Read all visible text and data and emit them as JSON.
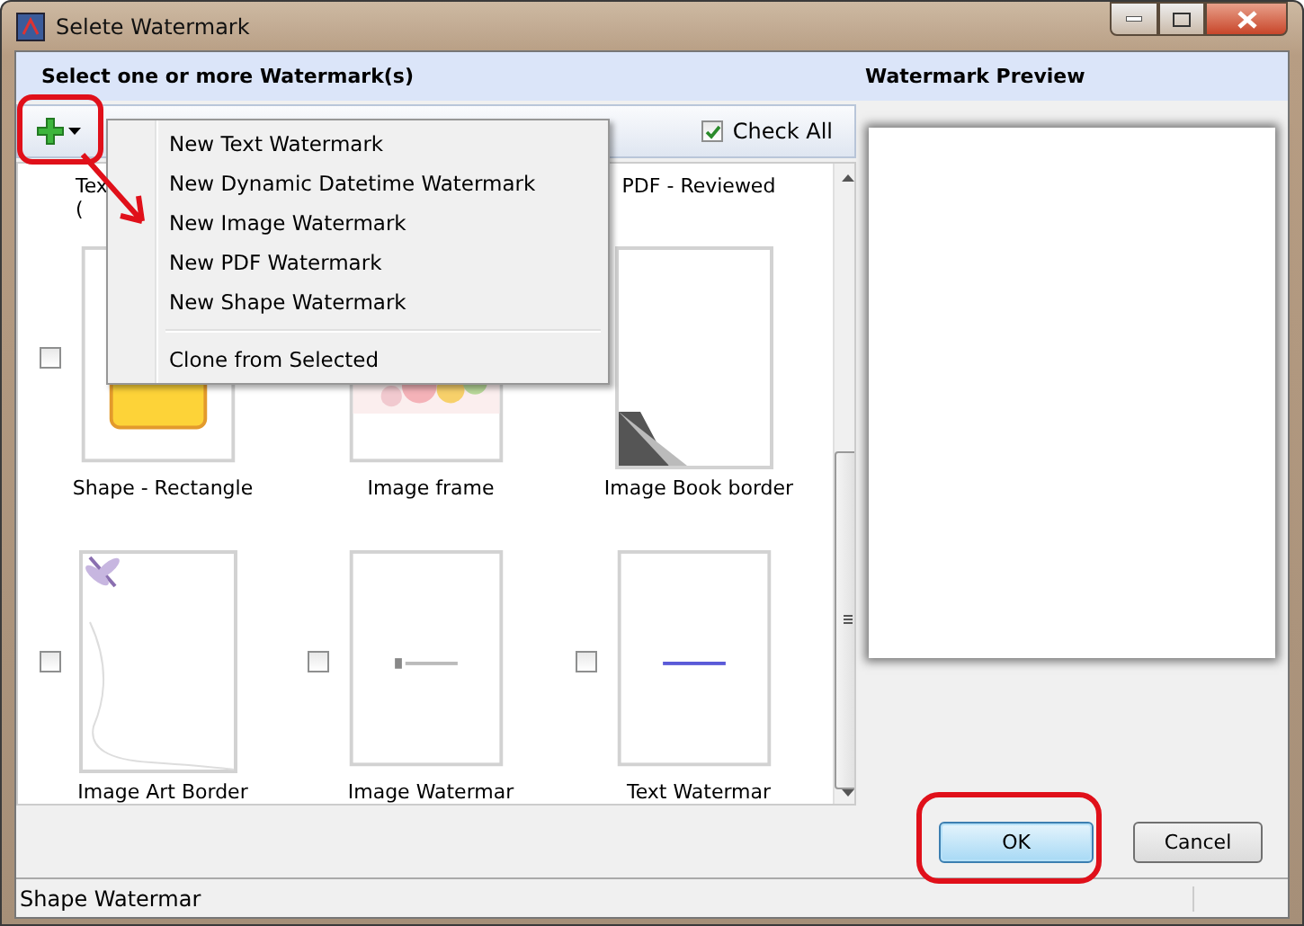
{
  "window": {
    "title": "Selete Watermark"
  },
  "list_header": "Select one or more Watermark(s)",
  "preview_header": "Watermark Preview",
  "toolbar": {
    "check_all": {
      "label": "Check All",
      "checked": true
    }
  },
  "menu": [
    {
      "kind": "item",
      "label": "New Text Watermark"
    },
    {
      "kind": "item",
      "label": "New Dynamic Datetime Watermark"
    },
    {
      "kind": "item",
      "label": "New Image Watermark"
    },
    {
      "kind": "item",
      "label": "New PDF Watermark"
    },
    {
      "kind": "item",
      "label": "New Shape Watermark"
    },
    {
      "kind": "separator"
    },
    {
      "kind": "item",
      "label": "Clone from Selected"
    }
  ],
  "rows": [
    {
      "kind": "partial",
      "items": [
        {
          "kind": "cut",
          "lines": [
            "Tex",
            "("
          ]
        },
        {
          "kind": "label",
          "lines": [
            "PDF - Reviewed"
          ]
        }
      ]
    },
    {
      "kind": "full",
      "items": [
        {
          "kind": "shape",
          "label": "Shape - Rectangle",
          "checked": false
        },
        {
          "kind": "frame",
          "label": "Image frame"
        },
        {
          "kind": "book",
          "label": "Image Book border"
        }
      ]
    },
    {
      "kind": "full",
      "items": [
        {
          "kind": "art",
          "label": "Image Art Border",
          "checked": false
        },
        {
          "label": "Image Watermar",
          "checked": false
        },
        {
          "kind": "text",
          "label": "Text Watermar",
          "checked": false
        }
      ]
    }
  ],
  "buttons": [
    {
      "label": "OK",
      "selected": true
    },
    {
      "label": "Cancel",
      "selected": false
    }
  ],
  "status_bar": "Shape Watermar"
}
